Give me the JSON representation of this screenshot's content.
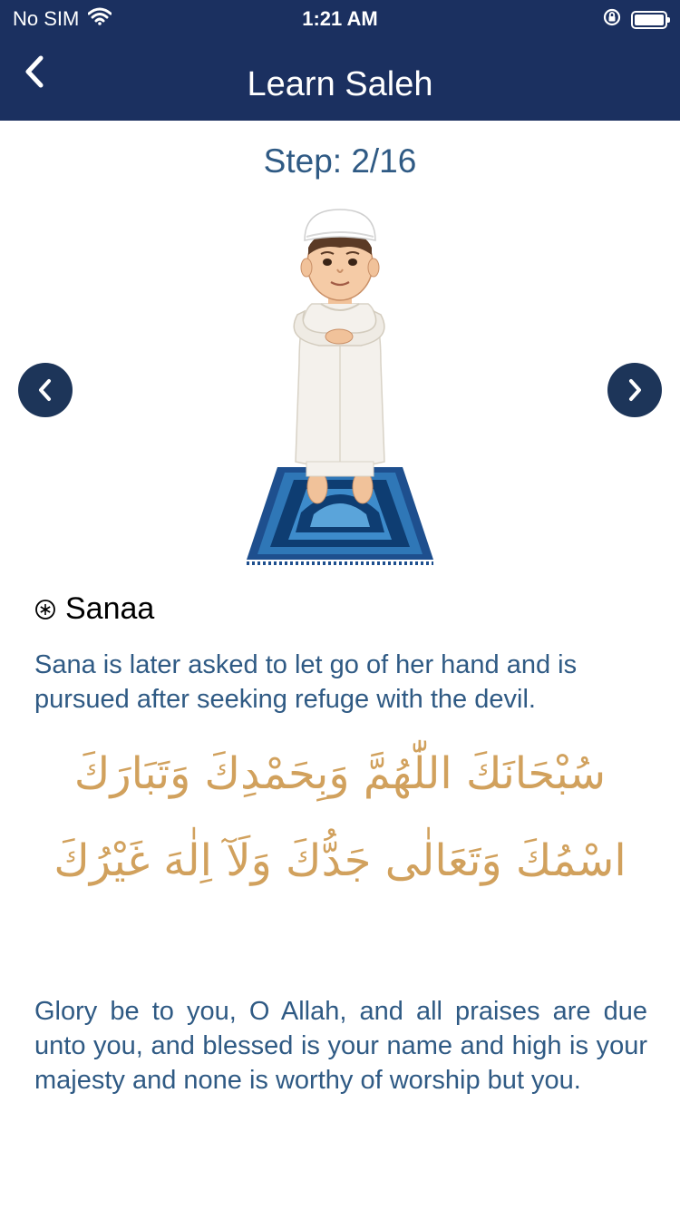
{
  "status_bar": {
    "carrier": "No SIM",
    "time": "1:21 AM",
    "icons": [
      "wifi-icon",
      "orientation-lock-icon",
      "battery-icon"
    ]
  },
  "header": {
    "title": "Learn Saleh",
    "back_icon": "chevron-left-icon"
  },
  "step": {
    "label": "Step: 2/16",
    "current": 2,
    "total": 16
  },
  "navigation": {
    "prev_icon": "chevron-left-icon",
    "next_icon": "chevron-right-icon"
  },
  "illustration": {
    "name": "praying-boy-on-mat"
  },
  "section": {
    "icon": "asterisk-circle-icon",
    "title": "Sanaa",
    "description": "Sana is later asked to let go of her hand and is pursued after seeking refuge with the devil.",
    "arabic": "سُبْحَانَكَ اللّٰهُمَّ وَبِحَمْدِكَ وَتَبَارَكَ اسْمُكَ وَتَعَالٰى جَدُّكَ وَلَآ اِلٰهَ غَيْرُكَ",
    "translation": "Glory be to you, O Allah, and all praises are due unto you, and blessed is your name and high is your majesty and none is worthy of worship but you."
  },
  "colors": {
    "header_bg": "#1b3060",
    "text_blue": "#2f5a84",
    "arabic_gold": "#d1a15d",
    "button_bg": "#1d3559"
  }
}
